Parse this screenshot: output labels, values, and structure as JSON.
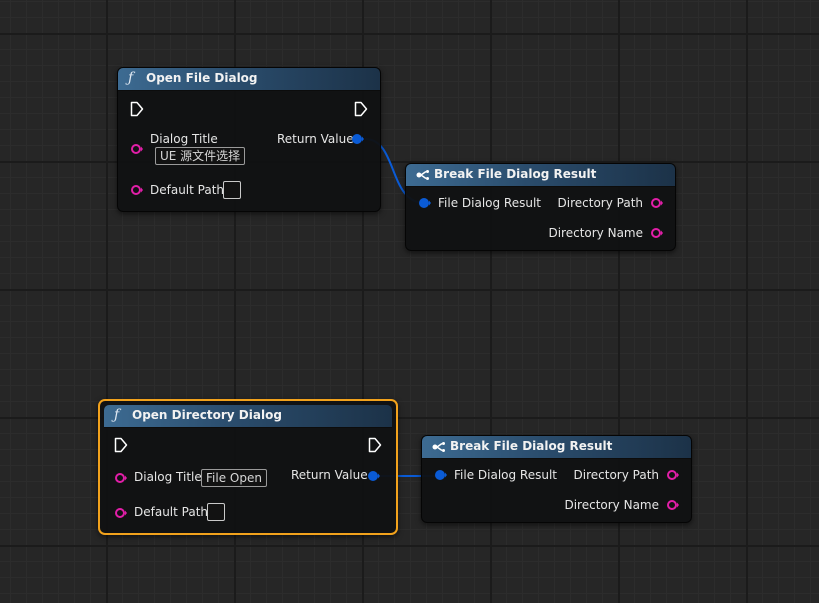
{
  "nodes": {
    "open_file": {
      "title": "Open File Dialog",
      "icon": "function-icon",
      "dialog_title_label": "Dialog Title",
      "dialog_title_value": "UE 源文件选择",
      "default_path_label": "Default Path",
      "return_value_label": "Return Value"
    },
    "break_file_1": {
      "title": "Break File Dialog Result",
      "icon": "break-struct-icon",
      "input_label": "File Dialog Result",
      "directory_path_label": "Directory Path",
      "directory_name_label": "Directory Name"
    },
    "open_directory": {
      "title": "Open Directory Dialog",
      "icon": "function-icon",
      "selected": true,
      "dialog_title_label": "Dialog Title",
      "dialog_title_value": "File Open",
      "default_path_label": "Default Path",
      "return_value_label": "Return Value"
    },
    "break_file_2": {
      "title": "Break File Dialog Result",
      "icon": "break-struct-icon",
      "input_label": "File Dialog Result",
      "directory_path_label": "Directory Path",
      "directory_name_label": "Directory Name"
    }
  },
  "colors": {
    "string_pin": "#e21ea8",
    "struct_pin": "#0a5bd6",
    "wire": "#0a5bd6",
    "exec_pin": "#ffffff",
    "selection_border": "#f2a21c",
    "function_header": "#3d6b92"
  }
}
